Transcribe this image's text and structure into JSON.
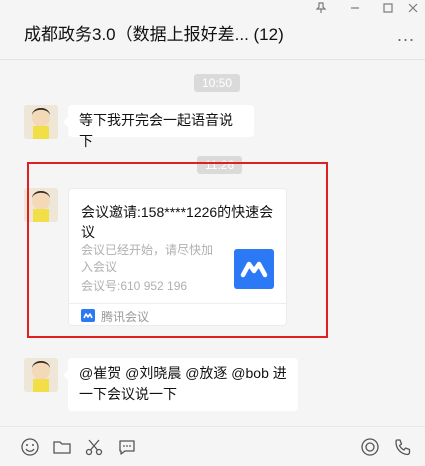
{
  "window": {
    "title": "成都政务3.0（数据上报好差... (12)",
    "more_label": "..."
  },
  "messages": {
    "ts1": "10:50",
    "msg1": "等下我开完会一起语音说下",
    "ts2": "11:26",
    "card": {
      "title": "会议邀请:158****1226的快速会议",
      "desc": "会议已经开始，请尽快加入会议",
      "meeting_id": "会议号:610 952 196",
      "source": "腾讯会议"
    },
    "msg2": "@崔贺 @刘晓晨 @放逐 @bob 进一下会议说一下"
  },
  "colors": {
    "brand_blue": "#2b79f5",
    "highlight_red": "#e02020"
  },
  "icons": {
    "toolbar": [
      "emoji-icon",
      "folder-icon",
      "scissors-icon",
      "chat-bubble-icon",
      "record-icon",
      "phone-icon"
    ]
  }
}
